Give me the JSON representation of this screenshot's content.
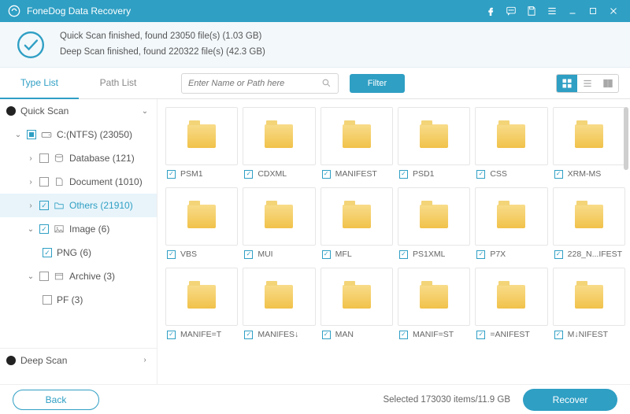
{
  "titlebar": {
    "app_name": "FoneDog Data Recovery"
  },
  "status": {
    "quick": "Quick Scan finished, found 23050 file(s) (1.03 GB)",
    "deep": "Deep Scan finished, found 220322 file(s) (42.3 GB)"
  },
  "tabs": {
    "type_list": "Type List",
    "path_list": "Path List"
  },
  "search": {
    "placeholder": "Enter Name or Path here"
  },
  "filter": "Filter",
  "sidebar": {
    "quick_scan": "Quick Scan",
    "drive": "C:(NTFS) (23050)",
    "database": "Database (121)",
    "document": "Document (1010)",
    "others": "Others (21910)",
    "image": "Image (6)",
    "png": "PNG (6)",
    "archive": "Archive (3)",
    "pf": "PF (3)",
    "deep_scan": "Deep Scan"
  },
  "grid": [
    "PSM1",
    "CDXML",
    "MANIFEST",
    "PSD1",
    "CSS",
    "XRM-MS",
    "VBS",
    "MUI",
    "MFL",
    "PS1XML",
    "P7X",
    "228_N...IFEST",
    "MANIFE=T",
    "MANIFES↓",
    "MAN",
    "MANIF=ST",
    "=ANIFEST",
    "M↓NIFEST"
  ],
  "footer": {
    "back": "Back",
    "selected": "Selected 173030 items/11.9 GB",
    "recover": "Recover"
  }
}
